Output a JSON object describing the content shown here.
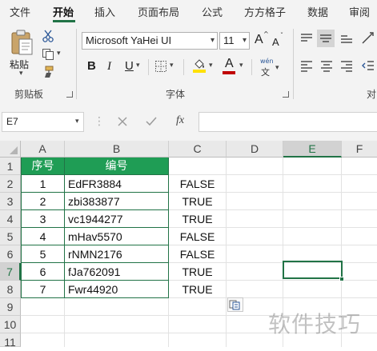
{
  "menu": {
    "tabs": [
      "文件",
      "开始",
      "插入",
      "页面布局",
      "公式",
      "方方格子",
      "数据",
      "审阅"
    ],
    "active_tab": "开始"
  },
  "ribbon": {
    "clipboard": {
      "paste_label": "粘贴",
      "group_label": "剪贴板"
    },
    "font": {
      "font_name": "Microsoft YaHei UI",
      "font_size": "11",
      "bold_label": "B",
      "italic_label": "I",
      "underline_label": "U",
      "font_color_label": "A",
      "grow_label": "A",
      "shrink_label": "A",
      "phonetic_top": "wén",
      "phonetic_bottom": "文",
      "group_label": "字体"
    },
    "alignment": {
      "group_label": "对"
    }
  },
  "formula_bar": {
    "name_box": "E7",
    "fx_label": "fx",
    "content": ""
  },
  "grid": {
    "columns": [
      "A",
      "B",
      "C",
      "D",
      "E",
      "F"
    ],
    "rows": [
      "1",
      "2",
      "3",
      "4",
      "5",
      "6",
      "7",
      "8",
      "9",
      "10",
      "11"
    ],
    "selected_column": "E",
    "selected_row": "7",
    "table_headers": [
      "序号",
      "编号"
    ],
    "table_rows": [
      {
        "num": "1",
        "code": "EdFR3884",
        "check": "FALSE"
      },
      {
        "num": "2",
        "code": "zbi383877",
        "check": "TRUE"
      },
      {
        "num": "3",
        "code": "vc1944277",
        "check": "TRUE"
      },
      {
        "num": "4",
        "code": "mHav5570",
        "check": "FALSE"
      },
      {
        "num": "5",
        "code": "rNMN2176",
        "check": "FALSE"
      },
      {
        "num": "6",
        "code": "fJa762091",
        "check": "TRUE"
      },
      {
        "num": "7",
        "code": "Fwr44920",
        "check": "TRUE"
      }
    ]
  },
  "watermark": "软件技巧",
  "colors": {
    "accent": "#217346",
    "header_fill": "#1f9d55",
    "underline_red": "#c00000",
    "highlight_yellow": "#ffe100"
  }
}
